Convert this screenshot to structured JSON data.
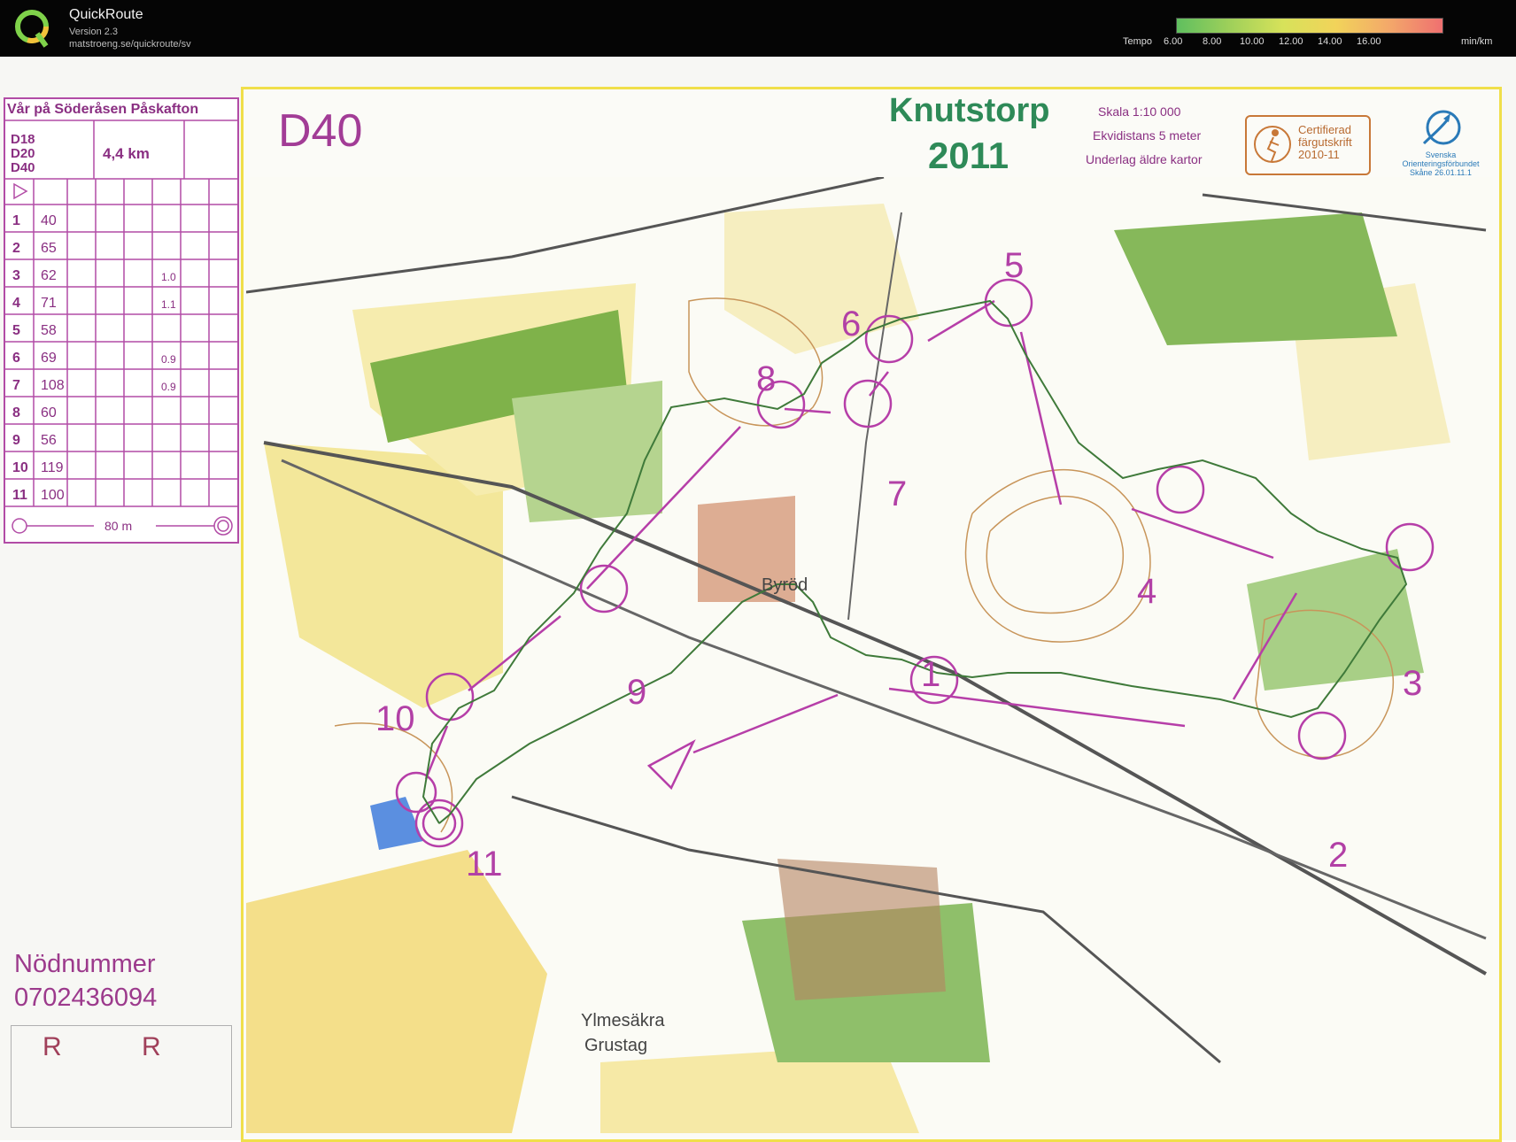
{
  "app": {
    "title": "QuickRoute",
    "version": "Version 2.3",
    "url": "matstroeng.se/quickroute/sv",
    "tempo_label": "Tempo",
    "tempo_ticks": [
      "6.00",
      "8.00",
      "10.00",
      "12.00",
      "14.00",
      "16.00"
    ],
    "tempo_unit": "min/km",
    "icon": "quickroute-logo-icon"
  },
  "legend": {
    "title": "Vår på Söderåsen Påskafton",
    "classes": [
      "D18",
      "D20",
      "D40"
    ],
    "length": "4,4 km",
    "controls": [
      {
        "num": "1",
        "code": "40",
        "dim": ""
      },
      {
        "num": "2",
        "code": "65",
        "dim": ""
      },
      {
        "num": "3",
        "code": "62",
        "dim": "1.0"
      },
      {
        "num": "4",
        "code": "71",
        "dim": "1.1"
      },
      {
        "num": "5",
        "code": "58",
        "dim": ""
      },
      {
        "num": "6",
        "code": "69",
        "dim": "0.9"
      },
      {
        "num": "7",
        "code": "108",
        "dim": "0.9"
      },
      {
        "num": "8",
        "code": "60",
        "dim": ""
      },
      {
        "num": "9",
        "code": "56",
        "dim": ""
      },
      {
        "num": "10",
        "code": "119",
        "dim": ""
      },
      {
        "num": "11",
        "code": "100",
        "dim": ""
      }
    ],
    "finish": "80 m"
  },
  "emergency": {
    "label": "Nödnummer",
    "number": "0702436094"
  },
  "r_labels": [
    "R",
    "R"
  ],
  "map": {
    "class": "D40",
    "title": "Knutstorp",
    "year": "2011",
    "scale": "Skala 1:10 000",
    "contour": "Ekvidistans 5 meter",
    "base": "Underlag äldre kartor",
    "cert_line1": "Certifierad",
    "cert_line2": "färgutskrift",
    "cert_line3": "2010-11",
    "sof_line1": "Svenska",
    "sof_line2": "Orienteringsförbundet",
    "sof_line3": "Skåne 26.01.11.1",
    "places": [
      "Byröd",
      "Ylmesäkra",
      "Grustag"
    ],
    "colors": {
      "course": "#b63ea8",
      "route": "#3f7a3a",
      "forest": "#7fb24a",
      "open": "#f5e27a"
    }
  }
}
